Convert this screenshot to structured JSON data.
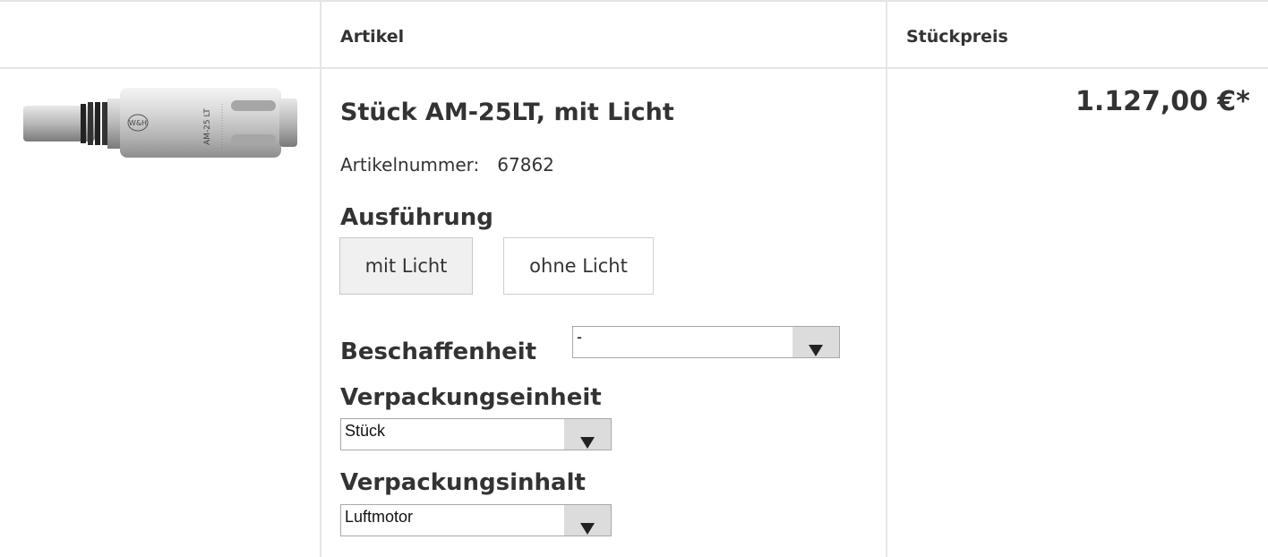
{
  "table": {
    "headers": {
      "article": "Artikel",
      "unit_price": "Stückpreis"
    }
  },
  "product": {
    "image_alt": "Luftmotor AM-25LT",
    "image_text": {
      "brand": "W&H",
      "model": "AM-25 LT"
    },
    "title": "Stück AM-25LT, mit Licht",
    "article_number_label": "Artikelnummer:",
    "article_number": "67862",
    "price": "1.127,00 €*"
  },
  "options": {
    "ausfuehrung": {
      "label": "Ausführung",
      "choices": [
        "mit Licht",
        "ohne Licht"
      ],
      "selected": "mit Licht"
    },
    "beschaffenheit": {
      "label": "Beschaffenheit",
      "value": "-"
    },
    "verpackungseinheit": {
      "label": "Verpackungseinheit",
      "value": "Stück"
    },
    "verpackungsinhalt": {
      "label": "Verpackungsinhalt",
      "value": "Luftmotor"
    }
  },
  "icons": {
    "dropdown": "triangle-down-icon"
  },
  "colors": {
    "border": "#e6e6e6",
    "text": "#333333",
    "selected_bg": "#f0f0f0",
    "dropdown_arrow_bg": "#dcdcdc"
  }
}
